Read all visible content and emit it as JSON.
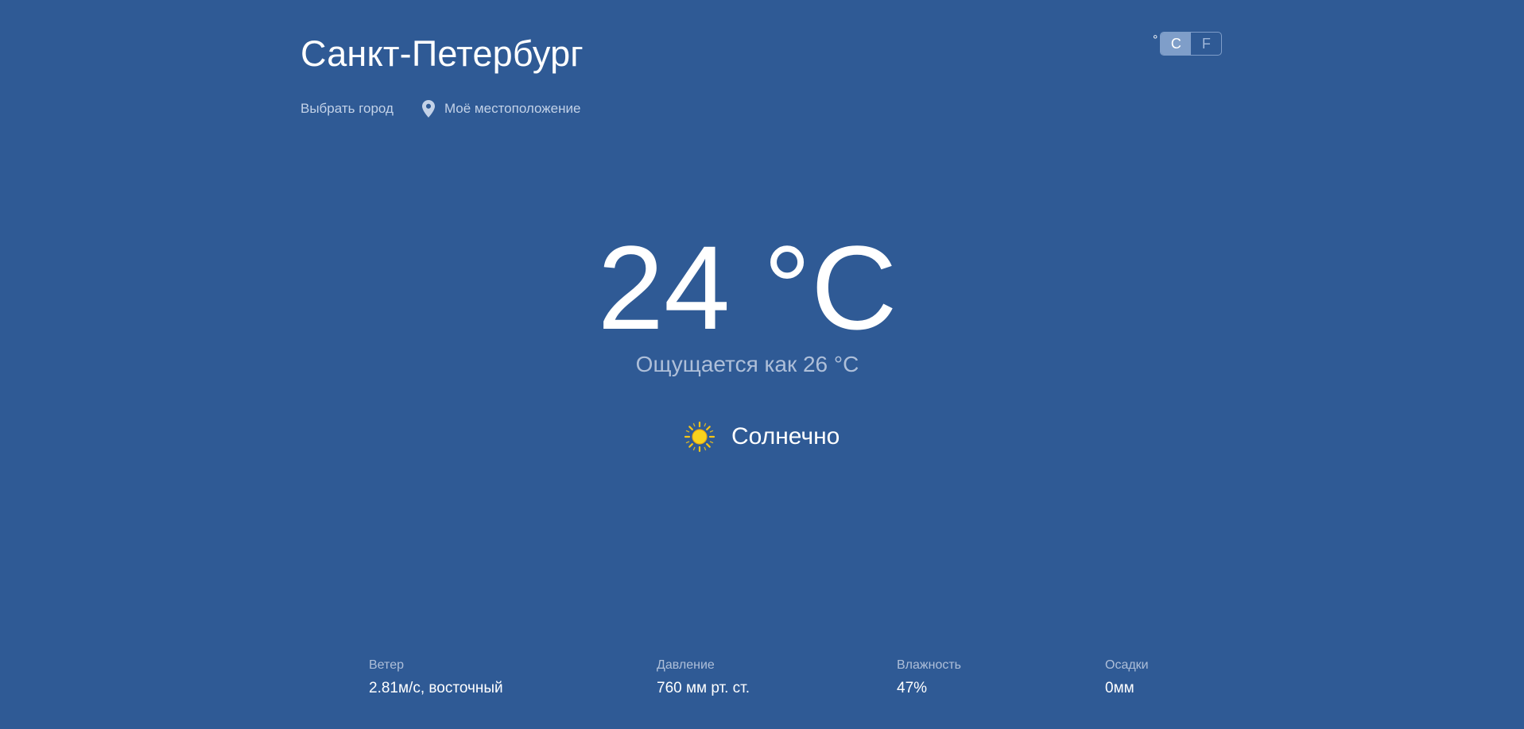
{
  "header": {
    "city": "Санкт-Петербург",
    "choose_city": "Выбрать город",
    "my_location": "Моё местоположение"
  },
  "units": {
    "degree_symbol": "°",
    "celsius": "C",
    "fahrenheit": "F",
    "selected": "C"
  },
  "current": {
    "temperature": "24 °C",
    "feels_like": "Ощущается как 26 °C",
    "condition": "Солнечно",
    "condition_icon": "sun-icon"
  },
  "stats": [
    {
      "label": "Ветер",
      "value": "2.81м/с, восточный"
    },
    {
      "label": "Давление",
      "value": "760 мм рт. ст."
    },
    {
      "label": "Влажность",
      "value": "47%"
    },
    {
      "label": "Осадки",
      "value": "0мм"
    }
  ],
  "colors": {
    "background": "#2f5a95",
    "accent": "#7f9ec9",
    "muted_text": "#aebfd9",
    "sun": "#f5c518"
  }
}
